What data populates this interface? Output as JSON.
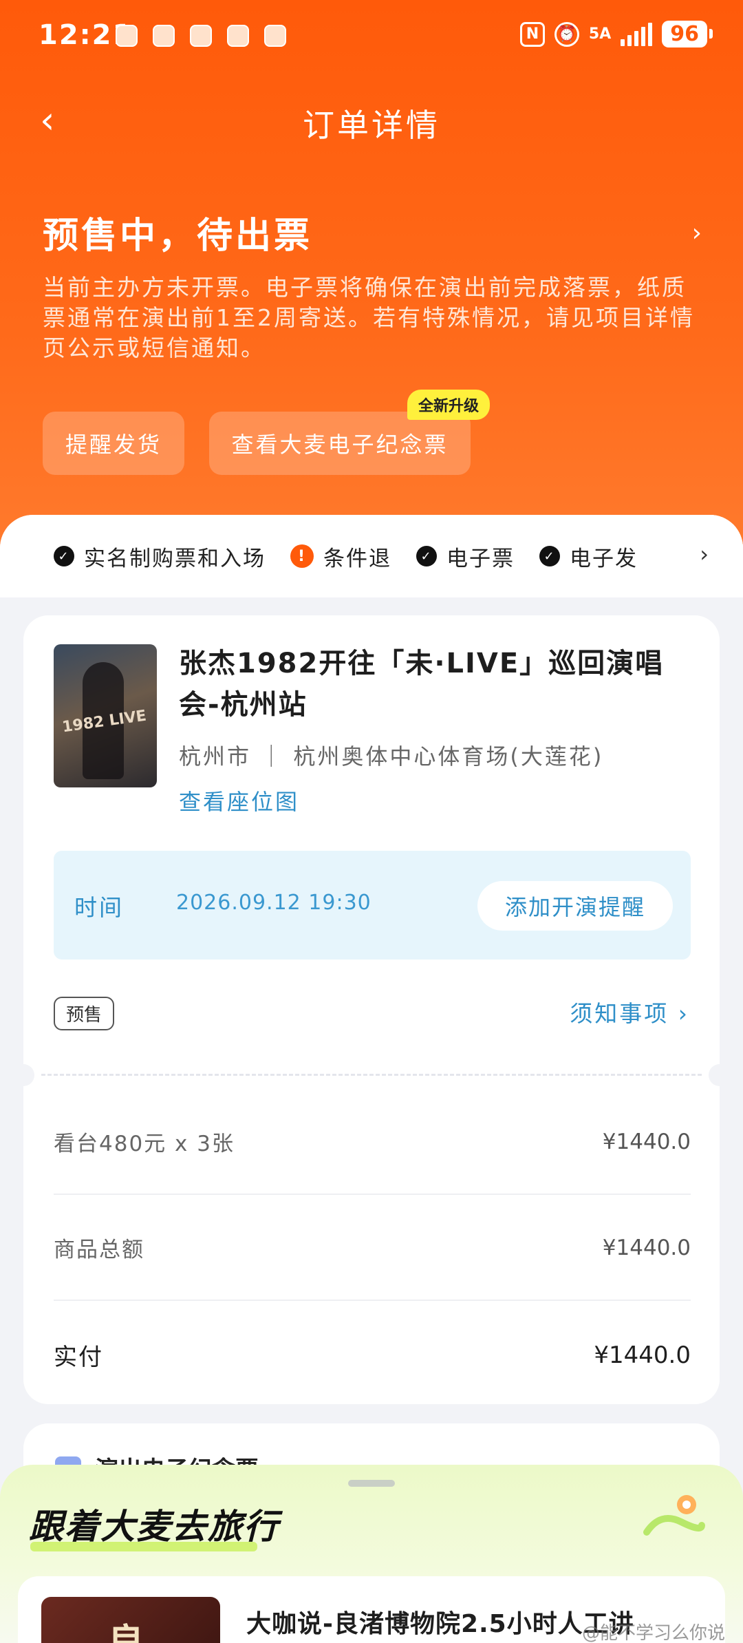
{
  "status_bar": {
    "time": "12:21",
    "network": "5A",
    "battery": "96"
  },
  "nav": {
    "back": "‹",
    "title": "订单详情"
  },
  "order_status": {
    "title": "预售中，待出票",
    "description": "当前主办方未开票。电子票将确保在演出前完成落票，纸质票通常在演出前1至2周寄送。若有特殊情况，请见项目详情页公示或短信通知。",
    "buttons": {
      "remind": "提醒发货",
      "memorial": "查看大麦电子纪念票"
    },
    "new_badge": "全新升级"
  },
  "features": [
    {
      "label": "实名制购票和入场",
      "icon": "check-icon"
    },
    {
      "label": "条件退",
      "icon": "warning-icon"
    },
    {
      "label": "电子票",
      "icon": "check-icon"
    },
    {
      "label": "电子发",
      "icon": "check-icon"
    }
  ],
  "show": {
    "title": "张杰1982开往「未·LIVE」巡回演唱会-杭州站",
    "city": "杭州市",
    "venue": "杭州奥体中心体育场(大莲花)",
    "seat_link": "查看座位图",
    "poster_text": "1982 LIVE"
  },
  "time_box": {
    "label": "时间",
    "value": "2026.09.12 19:30",
    "button": "添加开演提醒"
  },
  "tags": {
    "presale": "预售",
    "notice": "须知事项"
  },
  "price": {
    "item_label": "看台480元 x 3张",
    "item_value": "¥1440.0",
    "subtotal_label": "商品总额",
    "subtotal_value": "¥1440.0",
    "paid_label": "实付",
    "paid_value": "¥1440.0"
  },
  "next_card": {
    "title": "演出电子纪念票"
  },
  "travel": {
    "title": "跟着大麦去旅行",
    "card_title": "大咖说-良渚博物院2.5小时人工讲",
    "card_image_text": "良"
  },
  "watermark": "@能不学习么你说",
  "colors": {
    "brand_orange": "#ff5a0a",
    "link_blue": "#2f8fc8",
    "badge_yellow": "#fff03c"
  }
}
